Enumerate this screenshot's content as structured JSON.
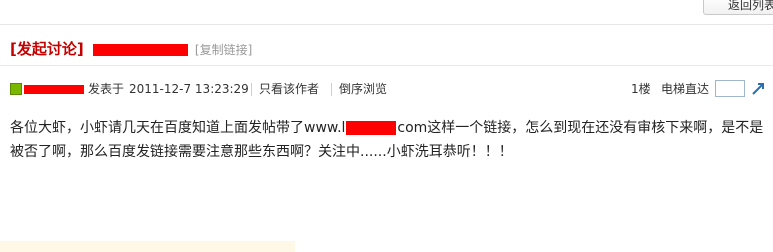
{
  "header": {
    "back_button_label": "返回列表"
  },
  "topic": {
    "bracket_open": "[",
    "tag": "发起讨论",
    "bracket_close": "]",
    "copy_link_label": "[复制链接]"
  },
  "post": {
    "posted_label": "发表于",
    "posted_time": "2011-12-7 13:23:29",
    "only_author_label": "只看该作者",
    "reverse_label": "倒序浏览",
    "floor_label": "1楼",
    "elevator_label": "电梯直达",
    "floor_input_value": "",
    "body_part1": "各位大虾，小虾请几天在百度知道上面发帖带了www.l",
    "body_part2": "com这样一个链接，怎么到现在还没有审核下来啊，是不是被否了啊，那么百度发链接需要注意那些东西啊？关注中......小虾洗耳恭听！！！"
  },
  "colors": {
    "accent_red": "#c40000",
    "redaction": "#ff0000",
    "link_blue": "#2a6fb6"
  },
  "icons": {
    "avatar": "user-level-icon",
    "go": "go-arrow-icon"
  }
}
